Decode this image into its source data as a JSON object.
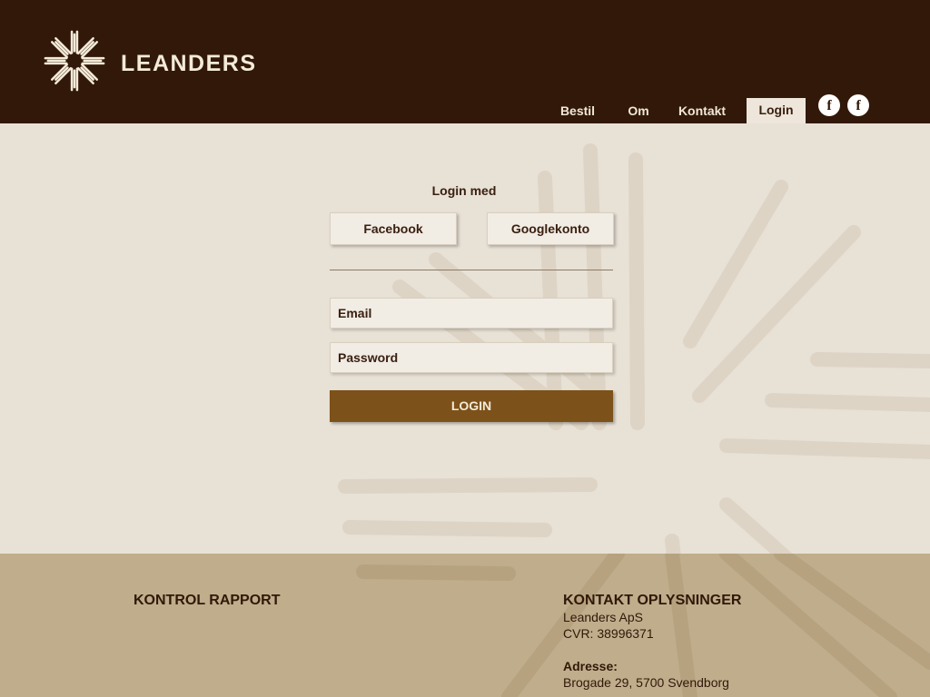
{
  "brand": {
    "name": "LEANDERS"
  },
  "nav": {
    "items": [
      {
        "label": "Bestil"
      },
      {
        "label": "Om"
      },
      {
        "label": "Kontakt"
      },
      {
        "label": "Login"
      }
    ],
    "social_icons": [
      "facebook-icon",
      "facebook-icon"
    ],
    "social_glyph": "f"
  },
  "login": {
    "title": "Login med",
    "facebook_label": "Facebook",
    "google_label": "Googlekonto",
    "email_placeholder": "Email",
    "password_placeholder": "Password",
    "submit_label": "LOGIN"
  },
  "footer": {
    "left_heading": "KONTROL RAPPORT",
    "right_heading": "KONTAKT OPLYSNINGER",
    "company": "Leanders ApS",
    "cvr": "CVR: 38996371",
    "address_label": "Adresse:",
    "address": "Brogade 29, 5700 Svendborg"
  },
  "colors": {
    "header_bg": "#311808",
    "page_bg": "#e8e1d6",
    "footer_bg": "#bfad8c",
    "login_button": "#7d511a"
  }
}
